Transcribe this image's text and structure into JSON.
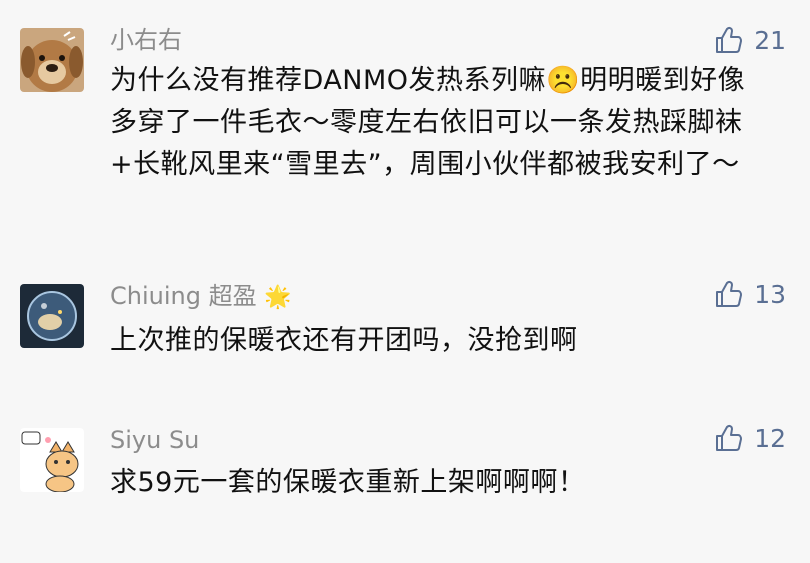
{
  "comments": [
    {
      "author": "小右右",
      "author_emoji": "",
      "likes": "21",
      "text": "为什么没有推荐DANMO发热系列嘛☹️明明暖到好像多穿了一件毛衣～零度左右依旧可以一条发热踩脚袜+长靴风里来“雪里去”，周围小伙伴都被我安利了～"
    },
    {
      "author": "Chiuing 超盈",
      "author_emoji": "🌟",
      "likes": "13",
      "text": "上次推的保暖衣还有开团吗，没抢到啊"
    },
    {
      "author": "Siyu Su",
      "author_emoji": "",
      "likes": "12",
      "text": "求59元一套的保暖衣重新上架啊啊啊！"
    }
  ],
  "colors": {
    "background": "#f7f7f7",
    "author": "#8c8c8c",
    "like_icon": "#5a6f93",
    "text": "#111111"
  },
  "icons": {
    "like": "thumbs-up-icon",
    "avatar_1": "dog-avatar",
    "avatar_2": "bubble-avatar",
    "avatar_3": "cat-avatar"
  }
}
